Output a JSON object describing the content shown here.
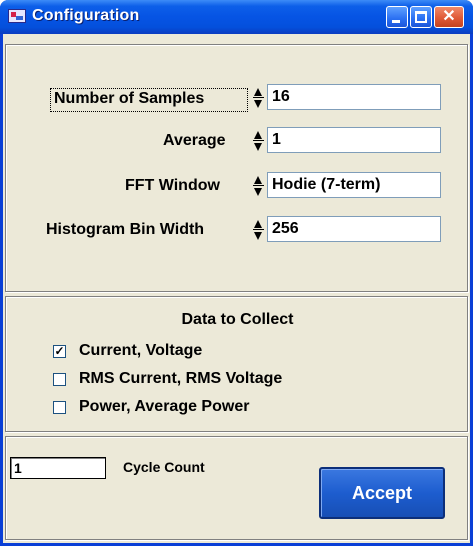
{
  "window": {
    "title": "Configuration",
    "close_glyph": "✕",
    "controls": [
      "minimize-icon",
      "maximize-icon",
      "close-icon"
    ]
  },
  "settings": {
    "number_of_samples": {
      "label": "Number of Samples",
      "value": "16"
    },
    "average": {
      "label": "Average",
      "value": "1"
    },
    "fft_window": {
      "label": "FFT Window",
      "value": "Hodie (7-term)"
    },
    "histogram_bin_width": {
      "label": "Histogram Bin Width",
      "value": "256"
    }
  },
  "data_to_collect": {
    "title": "Data to Collect",
    "items": [
      {
        "label": "Current,  Voltage",
        "checked": true,
        "mark": "✓"
      },
      {
        "label": "RMS Current, RMS Voltage",
        "checked": false,
        "mark": ""
      },
      {
        "label": "Power, Average Power",
        "checked": false,
        "mark": ""
      }
    ]
  },
  "cycle": {
    "value": "1",
    "label": "Cycle Count"
  },
  "accept_label": "Accept",
  "colors": {
    "titlebar": "#0654e4",
    "face": "#ece9d8",
    "accent": "#1d5dcf"
  }
}
